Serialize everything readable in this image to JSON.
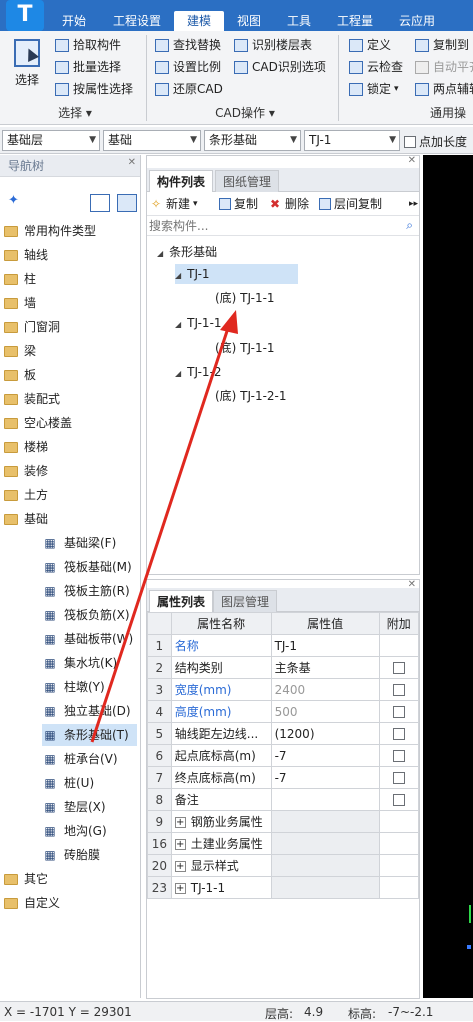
{
  "app": {
    "logo_letter": "T"
  },
  "ribbon_tabs": [
    {
      "label": "开始"
    },
    {
      "label": "工程设置"
    },
    {
      "label": "建模"
    },
    {
      "label": "视图"
    },
    {
      "label": "工具"
    },
    {
      "label": "工程量"
    },
    {
      "label": "云应用"
    }
  ],
  "ribbon": {
    "select_group": {
      "big_button": "选择",
      "buttons": [
        "拾取构件",
        "批量选择",
        "按属性选择"
      ],
      "label": "选择"
    },
    "cad_group": {
      "col1": [
        "查找替换",
        "设置比例",
        "还原CAD"
      ],
      "col2": [
        "识别楼层表",
        "CAD识别选项"
      ],
      "label": "CAD操作"
    },
    "common_group": {
      "col1": [
        "定义",
        "云检查",
        "锁定"
      ],
      "col2": [
        "复制到",
        "自动平齐",
        "两点辅轴"
      ],
      "label": "通用操"
    }
  },
  "selectors": {
    "floor": "基础层",
    "category": "基础",
    "type": "条形基础",
    "component": "TJ-1",
    "checkbox_label": "点加长度"
  },
  "nav": {
    "title": "导航树",
    "top_items": [
      "常用构件类型",
      "轴线",
      "柱",
      "墙",
      "门窗洞",
      "梁",
      "板",
      "装配式",
      "空心楼盖",
      "楼梯",
      "装修",
      "土方",
      "基础"
    ],
    "foundation_items": [
      "基础梁(F)",
      "筏板基础(M)",
      "筏板主筋(R)",
      "筏板负筋(X)",
      "基础板带(W)",
      "集水坑(K)",
      "柱墩(Y)",
      "独立基础(D)",
      "条形基础(T)",
      "桩承台(V)",
      "桩(U)",
      "垫层(X)",
      "地沟(G)",
      "砖胎膜"
    ],
    "bottom_items": [
      "其它",
      "自定义"
    ]
  },
  "component_panel": {
    "tabs": [
      "构件列表",
      "图纸管理"
    ],
    "tools": {
      "new": "新建",
      "copy": "复制",
      "delete": "删除",
      "floor_copy": "层间复制"
    },
    "search_placeholder": "搜索构件...",
    "tree": {
      "root": "条形基础",
      "nodes": [
        {
          "label": "TJ-1",
          "child": "(底) TJ-1-1"
        },
        {
          "label": "TJ-1-1",
          "child": "(底) TJ-1-1"
        },
        {
          "label": "TJ-1-2",
          "child": "(底) TJ-1-2-1"
        }
      ]
    }
  },
  "property_panel": {
    "tabs": [
      "属性列表",
      "图层管理"
    ],
    "headers": {
      "name": "属性名称",
      "value": "属性值",
      "extra": "附加"
    },
    "rows": [
      {
        "num": "1",
        "name": "名称",
        "value": "TJ-1"
      },
      {
        "num": "2",
        "name": "结构类别",
        "value": "主条基"
      },
      {
        "num": "3",
        "name": "宽度(mm)",
        "value": "2400"
      },
      {
        "num": "4",
        "name": "高度(mm)",
        "value": "500"
      },
      {
        "num": "5",
        "name": "轴线距左边线...",
        "value": "(1200)"
      },
      {
        "num": "6",
        "name": "起点底标高(m)",
        "value": "-7"
      },
      {
        "num": "7",
        "name": "终点底标高(m)",
        "value": "-7"
      },
      {
        "num": "8",
        "name": "备注",
        "value": ""
      },
      {
        "num": "9",
        "name": "钢筋业务属性",
        "value": ""
      },
      {
        "num": "16",
        "name": "土建业务属性",
        "value": ""
      },
      {
        "num": "20",
        "name": "显示样式",
        "value": ""
      },
      {
        "num": "23",
        "name": "TJ-1-1",
        "value": ""
      }
    ]
  },
  "status": {
    "coords": "X = -1701 Y = 29301",
    "floor_height_label": "层高:",
    "floor_height": "4.9",
    "elevation_label": "标高:",
    "elevation": "-7~-2.1"
  },
  "colors": {
    "ribbon_blue": "#2b6fc3",
    "link_blue": "#2b6bd6",
    "arrow_red": "#e0281f",
    "selected_row": "#cfe3f7"
  }
}
